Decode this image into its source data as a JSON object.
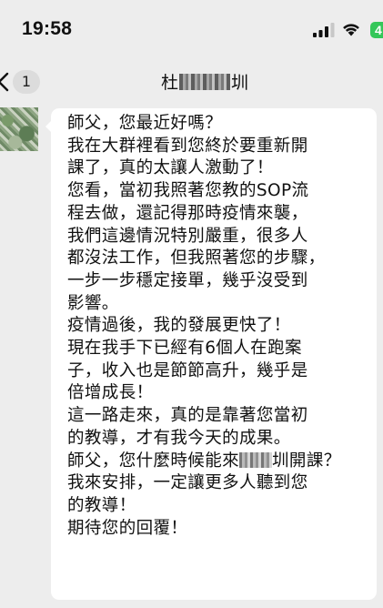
{
  "status_bar": {
    "time": "19:58",
    "battery": "4",
    "icons": [
      "cellular-signal-icon",
      "wifi-icon",
      "battery-icon"
    ],
    "battery_color": "#34c759"
  },
  "nav": {
    "unread_count": "1",
    "title_prefix": "杜",
    "title_suffix": "圳",
    "back_icon": "chevron-left-icon"
  },
  "message": {
    "bubble_color": "#ffffff",
    "lines": [
      "師父，您最近好嗎？",
      "我在大群裡看到您終於要重新開",
      "課了，真的太讓人激動了！",
      "您看，當初我照著您教的SOP流",
      "程去做，還記得那時疫情來襲，",
      "我們這邊情況特別嚴重，很多人",
      "都沒法工作，但我照著您的步驟，",
      "一步一步穩定接單，幾乎沒受到",
      "影響。",
      "疫情過後，我的發展更快了！",
      "現在我手下已經有6個人在跑案",
      "子，收入也是節節高升，幾乎是",
      "倍增成長！",
      "這一路走來，真的是靠著您當初",
      "的教導，才有我今天的成果。"
    ],
    "line_15_before": "師父，您什麼時候能來",
    "line_15_after": "圳開課？",
    "lines_after": [
      "我來安排，一定讓更多人聽到您",
      "的教導！",
      "期待您的回覆！"
    ]
  }
}
